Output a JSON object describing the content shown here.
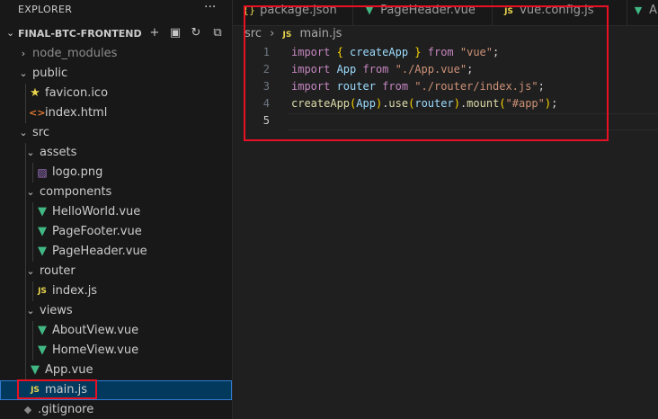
{
  "explorer": {
    "title": "EXPLORER",
    "more_label": "···",
    "project": "FINAL-BTC-FRONTEND",
    "actions": [
      {
        "name": "new-file",
        "glyph": "+"
      },
      {
        "name": "new-folder",
        "glyph": "▣"
      },
      {
        "name": "refresh",
        "glyph": "↻"
      },
      {
        "name": "collapse-all",
        "glyph": "⧉"
      }
    ],
    "tree": [
      {
        "label": "node_modules",
        "type": "folder",
        "expanded": false,
        "depth": 0,
        "dimmed": true
      },
      {
        "label": "public",
        "type": "folder",
        "expanded": true,
        "depth": 0
      },
      {
        "label": "favicon.ico",
        "type": "file",
        "icon": "star-icon",
        "depth": 1
      },
      {
        "label": "index.html",
        "type": "file",
        "icon": "html-icon",
        "depth": 1
      },
      {
        "label": "src",
        "type": "folder",
        "expanded": true,
        "depth": 0
      },
      {
        "label": "assets",
        "type": "folder",
        "expanded": true,
        "depth": 1
      },
      {
        "label": "logo.png",
        "type": "file",
        "icon": "image-icon",
        "depth": 2
      },
      {
        "label": "components",
        "type": "folder",
        "expanded": true,
        "depth": 1
      },
      {
        "label": "HelloWorld.vue",
        "type": "file",
        "icon": "vue-icon",
        "depth": 2
      },
      {
        "label": "PageFooter.vue",
        "type": "file",
        "icon": "vue-icon",
        "depth": 2
      },
      {
        "label": "PageHeader.vue",
        "type": "file",
        "icon": "vue-icon",
        "depth": 2
      },
      {
        "label": "router",
        "type": "folder",
        "expanded": true,
        "depth": 1
      },
      {
        "label": "index.js",
        "type": "file",
        "icon": "js-icon",
        "depth": 2
      },
      {
        "label": "views",
        "type": "folder",
        "expanded": true,
        "depth": 1
      },
      {
        "label": "AboutView.vue",
        "type": "file",
        "icon": "vue-icon",
        "depth": 2
      },
      {
        "label": "HomeView.vue",
        "type": "file",
        "icon": "vue-icon",
        "depth": 2
      },
      {
        "label": "App.vue",
        "type": "file",
        "icon": "vue-icon",
        "depth": 1
      },
      {
        "label": "main.js",
        "type": "file",
        "icon": "js-icon",
        "depth": 1,
        "selected": true
      },
      {
        "label": ".gitignore",
        "type": "file",
        "icon": "git-icon",
        "depth": 0
      }
    ]
  },
  "tabs": [
    {
      "label": "package.json",
      "icon": "json-icon",
      "glyph": "{}"
    },
    {
      "label": "PageHeader.vue",
      "icon": "vue-icon",
      "glyph": "▼"
    },
    {
      "label": "vue.config.js",
      "icon": "js-icon",
      "glyph": "JS"
    },
    {
      "label": "App",
      "icon": "vue-icon",
      "glyph": "▼"
    }
  ],
  "breadcrumb": {
    "folder": "src",
    "separator": "›",
    "file_icon": "JS",
    "file": "main.js"
  },
  "editor": {
    "line_numbers": [
      "1",
      "2",
      "3",
      "4",
      "5"
    ],
    "active_line": "5",
    "lines": [
      [
        [
          "kw",
          "import "
        ],
        [
          "br",
          "{ "
        ],
        [
          "var",
          "createApp"
        ],
        [
          "br",
          " }"
        ],
        [
          "kw",
          " from "
        ],
        [
          "str",
          "\"vue\""
        ],
        [
          "pl",
          ";"
        ]
      ],
      [
        [
          "kw",
          "import "
        ],
        [
          "var",
          "App"
        ],
        [
          "kw",
          " from "
        ],
        [
          "str",
          "\"./App.vue\""
        ],
        [
          "pl",
          ";"
        ]
      ],
      [
        [
          "kw",
          "import "
        ],
        [
          "var",
          "router"
        ],
        [
          "kw",
          " from "
        ],
        [
          "str",
          "\"./router/index.js\""
        ],
        [
          "pl",
          ";"
        ]
      ],
      [
        [
          "fn",
          "createApp"
        ],
        [
          "br",
          "("
        ],
        [
          "var",
          "App"
        ],
        [
          "br",
          ")"
        ],
        [
          "pl",
          "."
        ],
        [
          "fn",
          "use"
        ],
        [
          "br",
          "("
        ],
        [
          "var",
          "router"
        ],
        [
          "br",
          ")"
        ],
        [
          "pl",
          "."
        ],
        [
          "fn",
          "mount"
        ],
        [
          "br",
          "("
        ],
        [
          "str",
          "\"#app\""
        ],
        [
          "br",
          ")"
        ],
        [
          "pl",
          ";"
        ]
      ],
      []
    ]
  },
  "colors": {
    "annotation_red": "#e81123",
    "vue_green": "#41b883",
    "js_yellow": "#e8d44d",
    "selection_blue": "#04395e"
  }
}
